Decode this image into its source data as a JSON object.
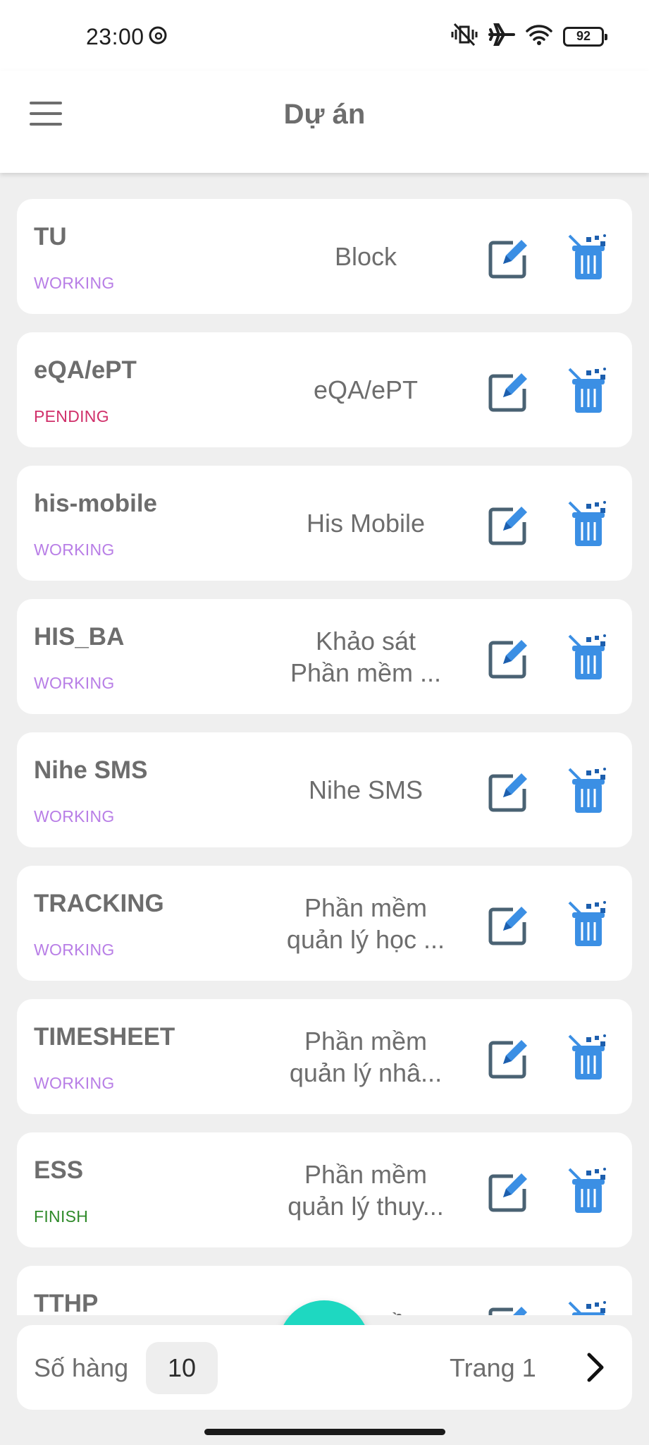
{
  "status_bar": {
    "time": "23:00",
    "battery": "92"
  },
  "header": {
    "title": "Dự án"
  },
  "colors": {
    "working": "#b87ee6",
    "pending": "#d0306a",
    "finish": "#2f8a2a",
    "accent": "#1ed8c1",
    "icon_blue": "#3b8fe4",
    "icon_dark": "#4a6273"
  },
  "projects": [
    {
      "name": "TU",
      "status": "WORKING",
      "description": "Block"
    },
    {
      "name": "eQA/ePT",
      "status": "PENDING",
      "description": "eQA/ePT"
    },
    {
      "name": "his-mobile",
      "status": "WORKING",
      "description": "His Mobile"
    },
    {
      "name": "HIS_BA",
      "status": "WORKING",
      "description": "Khảo sát\nPhần mềm ..."
    },
    {
      "name": "Nihe SMS",
      "status": "WORKING",
      "description": "Nihe SMS"
    },
    {
      "name": "TRACKING",
      "status": "WORKING",
      "description": "Phần mềm\nquản lý học ..."
    },
    {
      "name": "TIMESHEET",
      "status": "WORKING",
      "description": "Phần mềm\nquản lý nhâ..."
    },
    {
      "name": "ESS",
      "status": "FINISH",
      "description": "Phần mềm\nquản lý thuy..."
    },
    {
      "name": "TTHP",
      "status": "",
      "description": "Phần mềm"
    }
  ],
  "footer": {
    "rows_label": "Số hàng",
    "rows_value": "10",
    "page_label": "Trang 1"
  },
  "icons": {
    "menu": "menu-icon",
    "edit": "edit-icon",
    "delete": "trash-icon",
    "next": "chevron-right-icon",
    "add": "plus-icon"
  }
}
